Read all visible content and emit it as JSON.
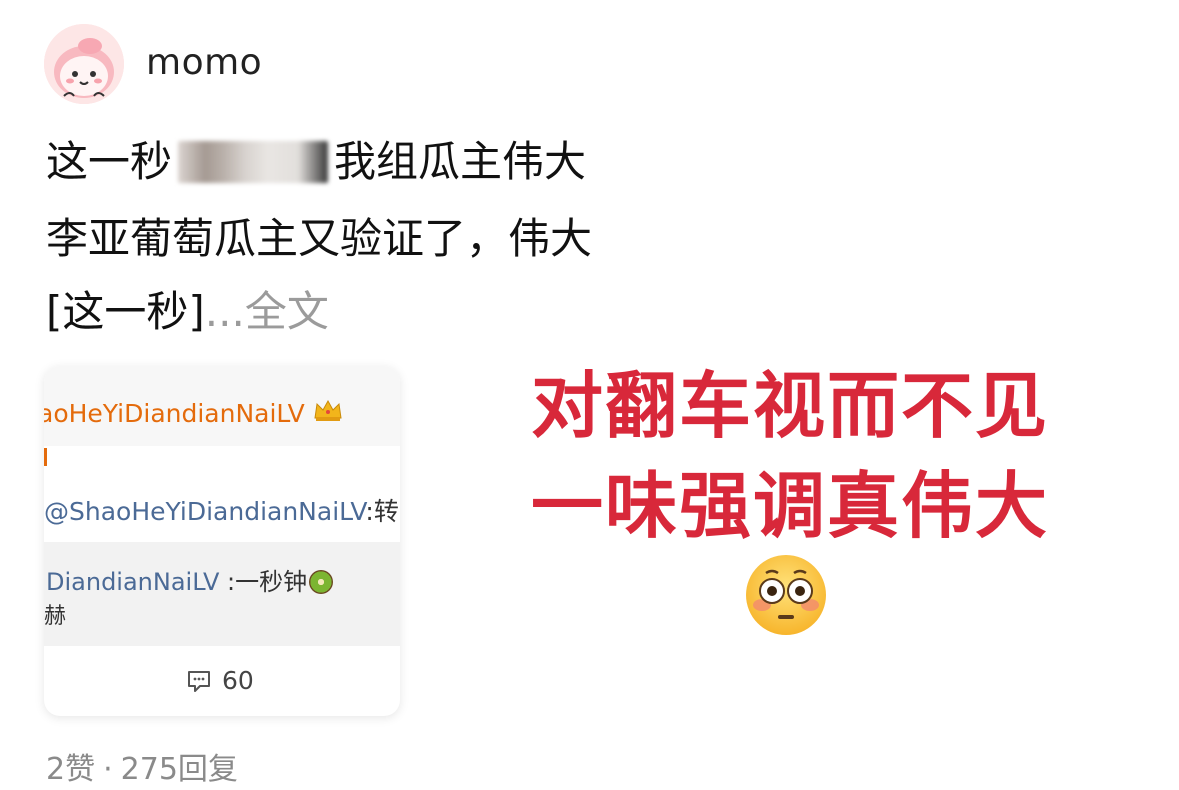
{
  "post": {
    "username": "momo",
    "line1_before": "这一秒",
    "line1_after": "我组瓜主伟大",
    "line2": "李亚葡萄瓜主又验证了，伟大",
    "line3_text": "[这一秒]",
    "ellipsis": "...",
    "fulltext_label": "全文"
  },
  "quoted_card": {
    "author": "aoHeYiDiandianNaiLV",
    "repost_mention": "@ShaoHeYiDiandianNaiLV",
    "repost_rest": ":转",
    "inner_mention": "DiandianNaiLV",
    "inner_rest": " :一秒钟",
    "inner_line2": "赫",
    "comment_count": "60"
  },
  "overlay": {
    "line1": "对翻车视而不见",
    "line2": "一味强调真伟大",
    "color": "#d8283a"
  },
  "footer": {
    "likes": "2赞",
    "separator": "·",
    "replies": "275回复"
  }
}
